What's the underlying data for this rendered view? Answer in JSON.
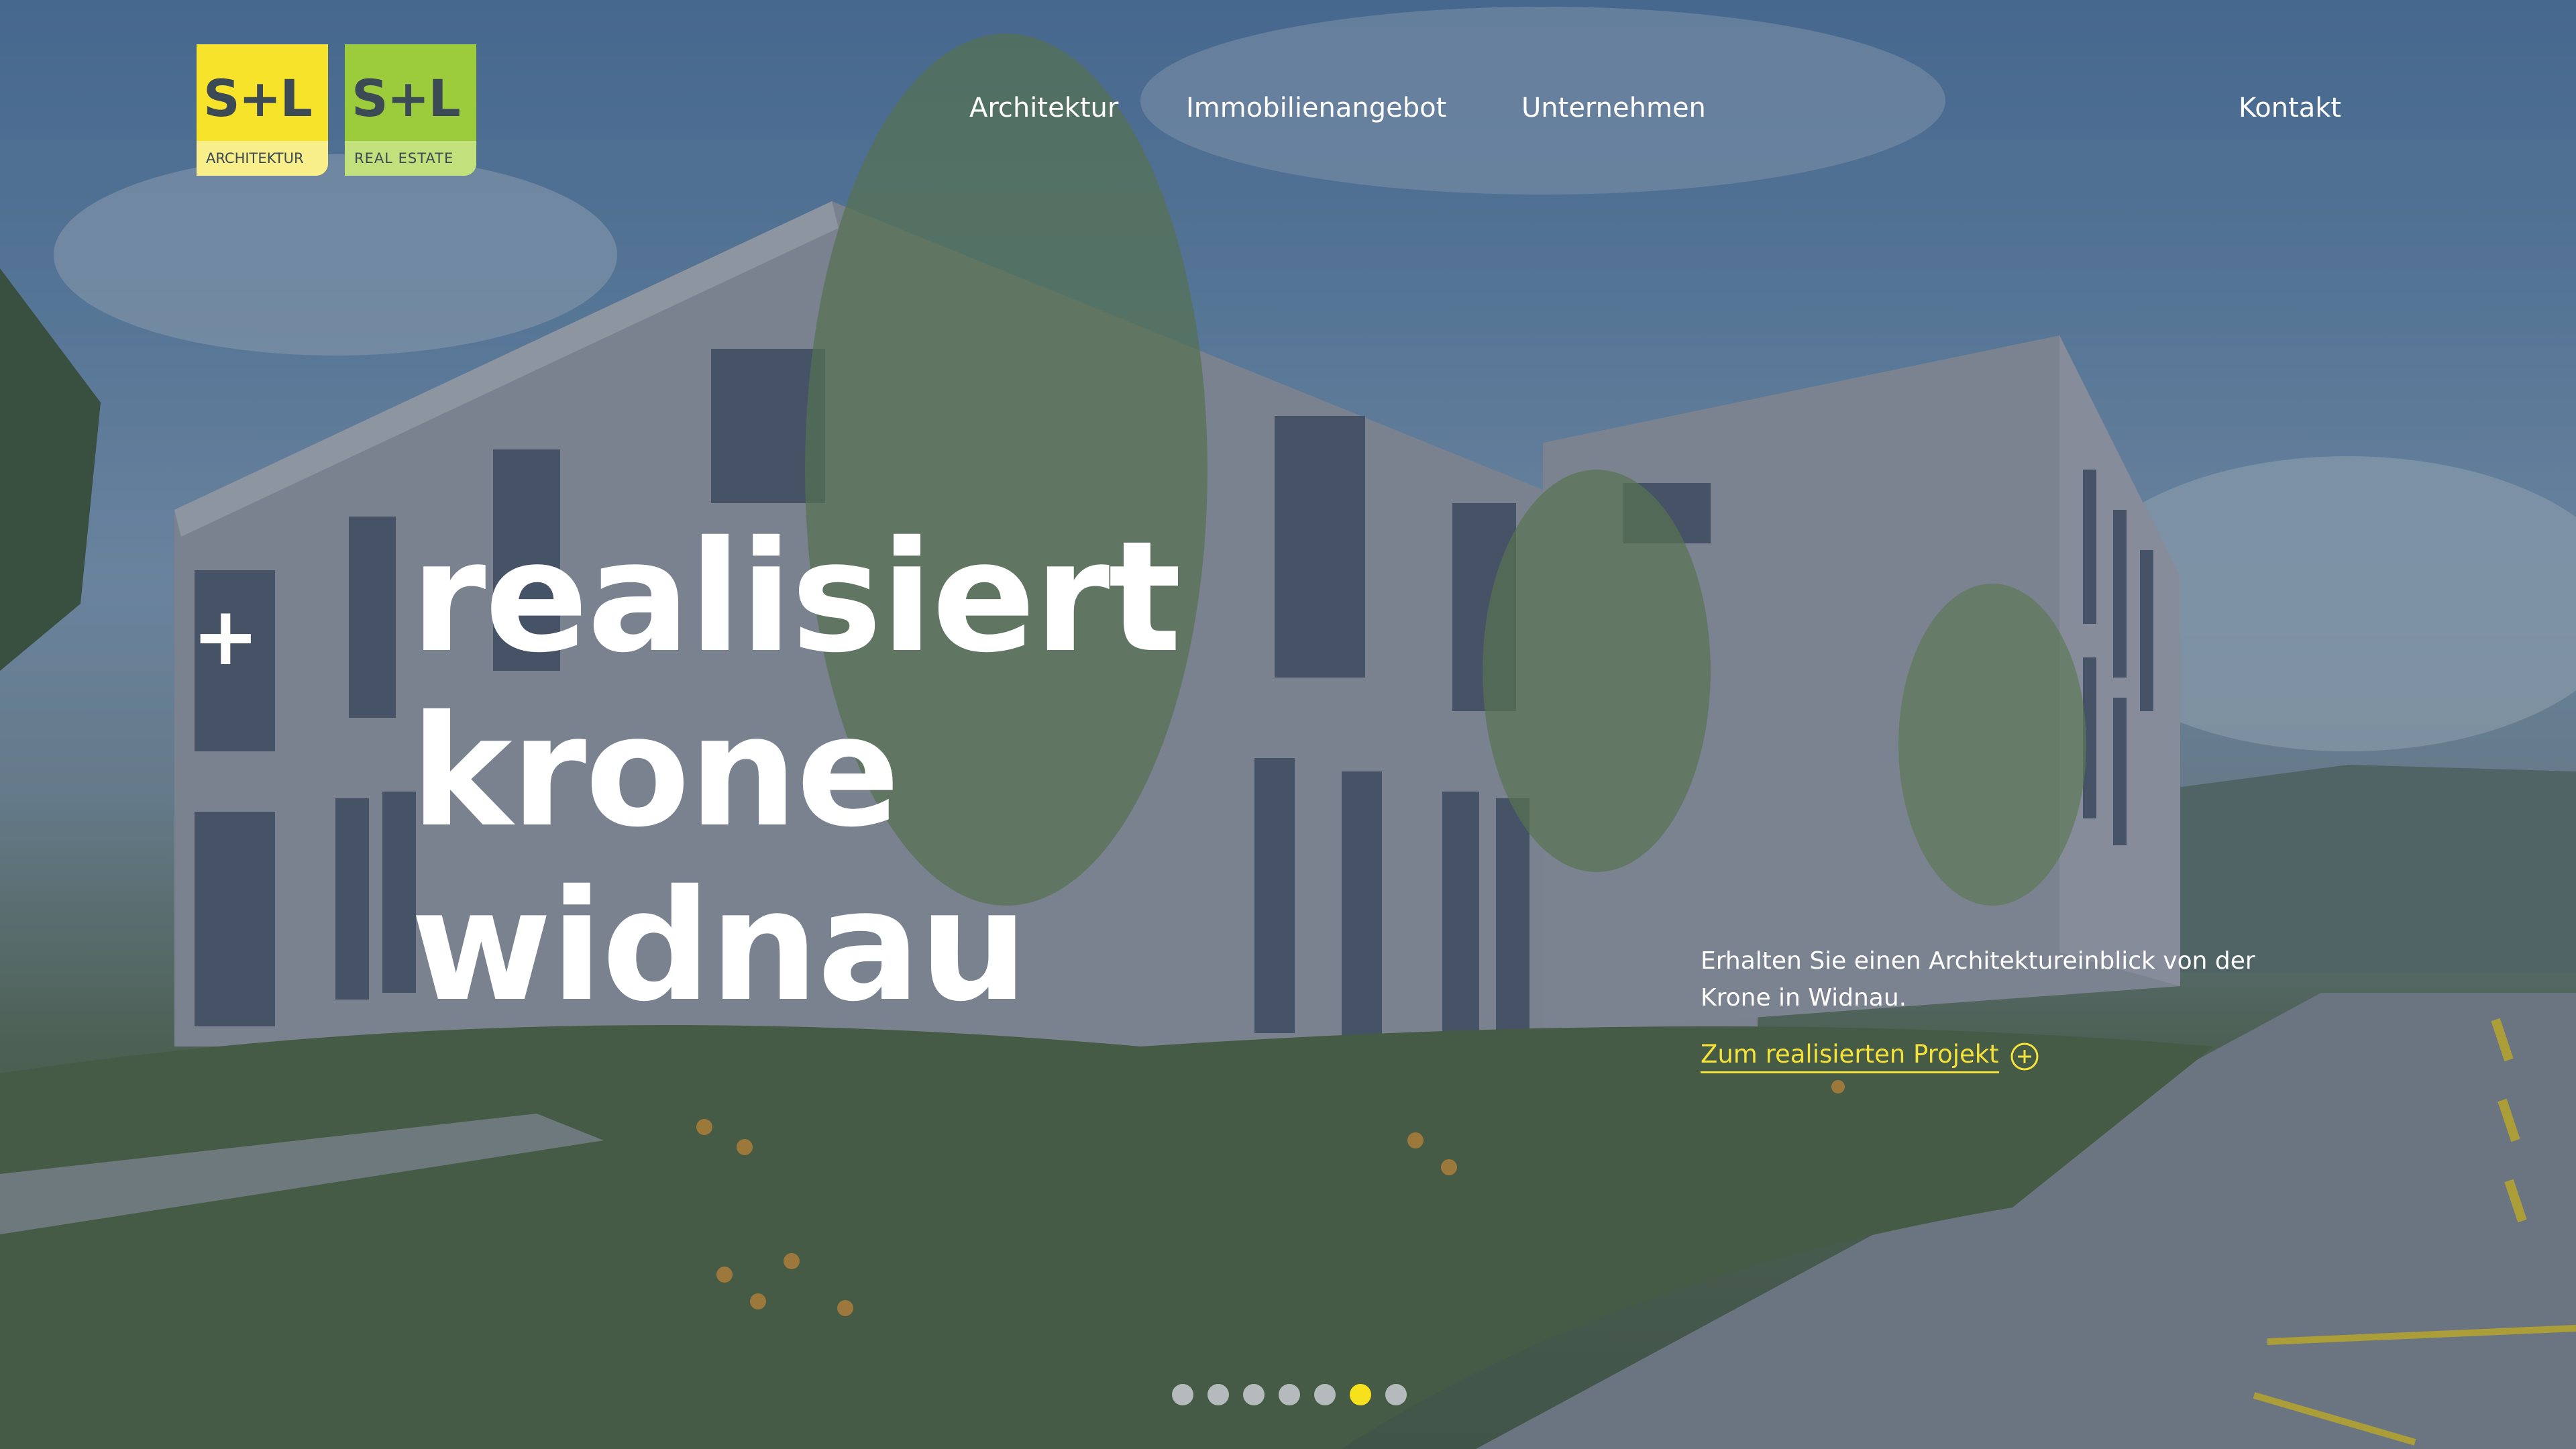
{
  "brand": {
    "architektur": {
      "mark": "S+L",
      "sub": "ARCHITEKTUR",
      "color": "#f6e32a"
    },
    "real_estate": {
      "mark": "S+L",
      "sub": "REAL ESTATE",
      "color": "#9ccb3b"
    }
  },
  "nav": {
    "architektur": "Architektur",
    "immobilienangebot": "Immobilienangebot",
    "unternehmen": "Unternehmen",
    "kontakt": "Kontakt"
  },
  "hero": {
    "plus": "+",
    "headline": [
      "realisiert",
      "krone",
      "widnau"
    ],
    "description": "Erhalten Sie einen Architektureinblick von der Krone in Widnau.",
    "cta_label": "Zum realisierten Projekt",
    "cta_icon": "plus-circle-icon"
  },
  "slider": {
    "count": 7,
    "active": 6
  },
  "colors": {
    "accent": "#f4e23a",
    "text": "#ffffff"
  }
}
